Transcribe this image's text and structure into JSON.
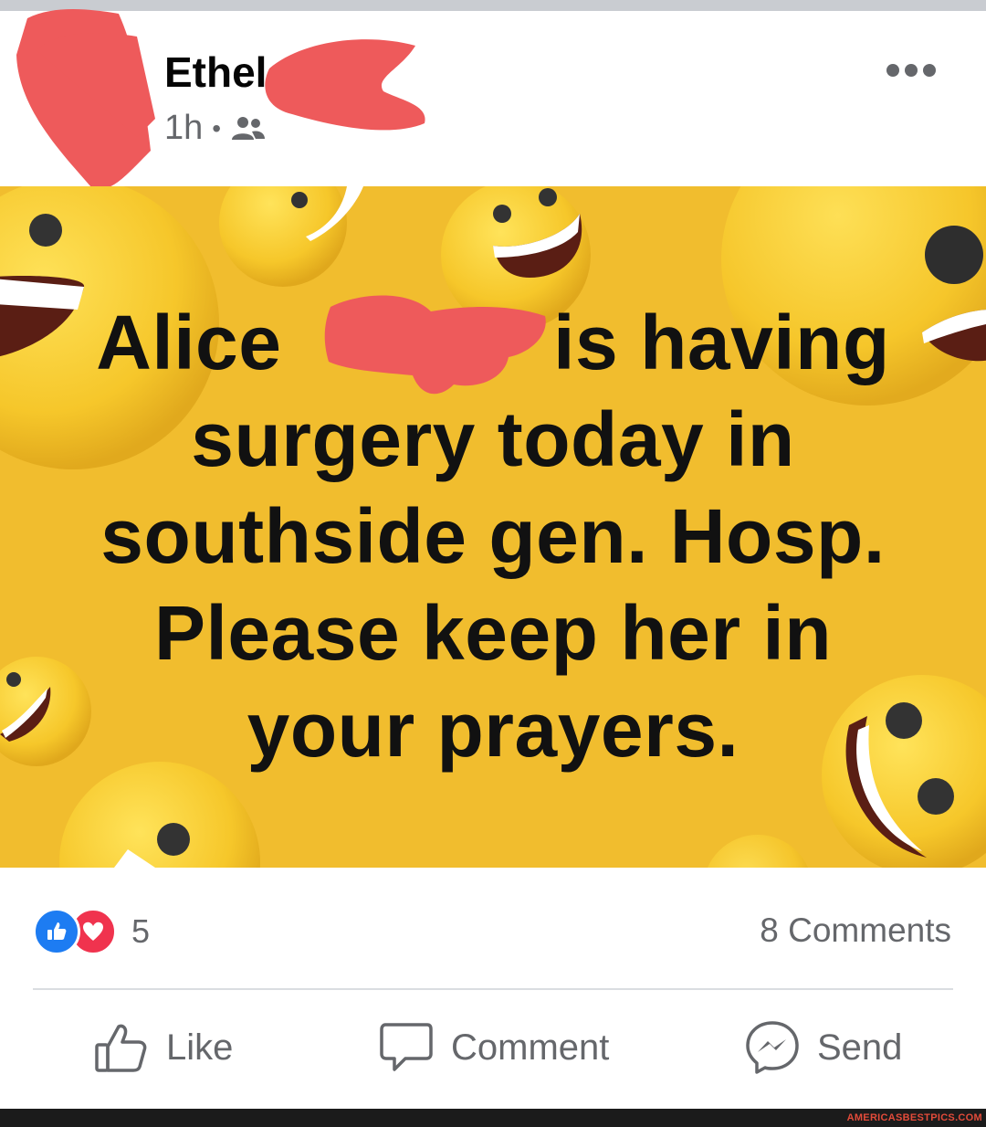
{
  "post": {
    "author_name": "Ethel",
    "timestamp": "1h",
    "separator": "•",
    "audience_icon": "friends-icon",
    "more_icon": "more-horizontal-icon"
  },
  "image": {
    "background_color": "#f1bd2e",
    "text_lines": [
      "Alice",
      "is having",
      "surgery today in",
      "southside gen. Hosp.",
      "Please keep her in",
      "your prayers."
    ],
    "decorations": "laughing-emoji-icon"
  },
  "stats": {
    "reaction_icons": [
      "thumbs-up-reaction-icon",
      "heart-reaction-icon"
    ],
    "reaction_count": "5",
    "comments_label": "8 Comments"
  },
  "actions": {
    "like_label": "Like",
    "comment_label": "Comment",
    "send_label": "Send"
  },
  "colors": {
    "text_gray": "#65676b",
    "like_blue": "#1d7cf2",
    "love_red": "#f0334e",
    "redaction": "#ee5a5b"
  },
  "watermark": "AMERICASBESTPICS.COM"
}
